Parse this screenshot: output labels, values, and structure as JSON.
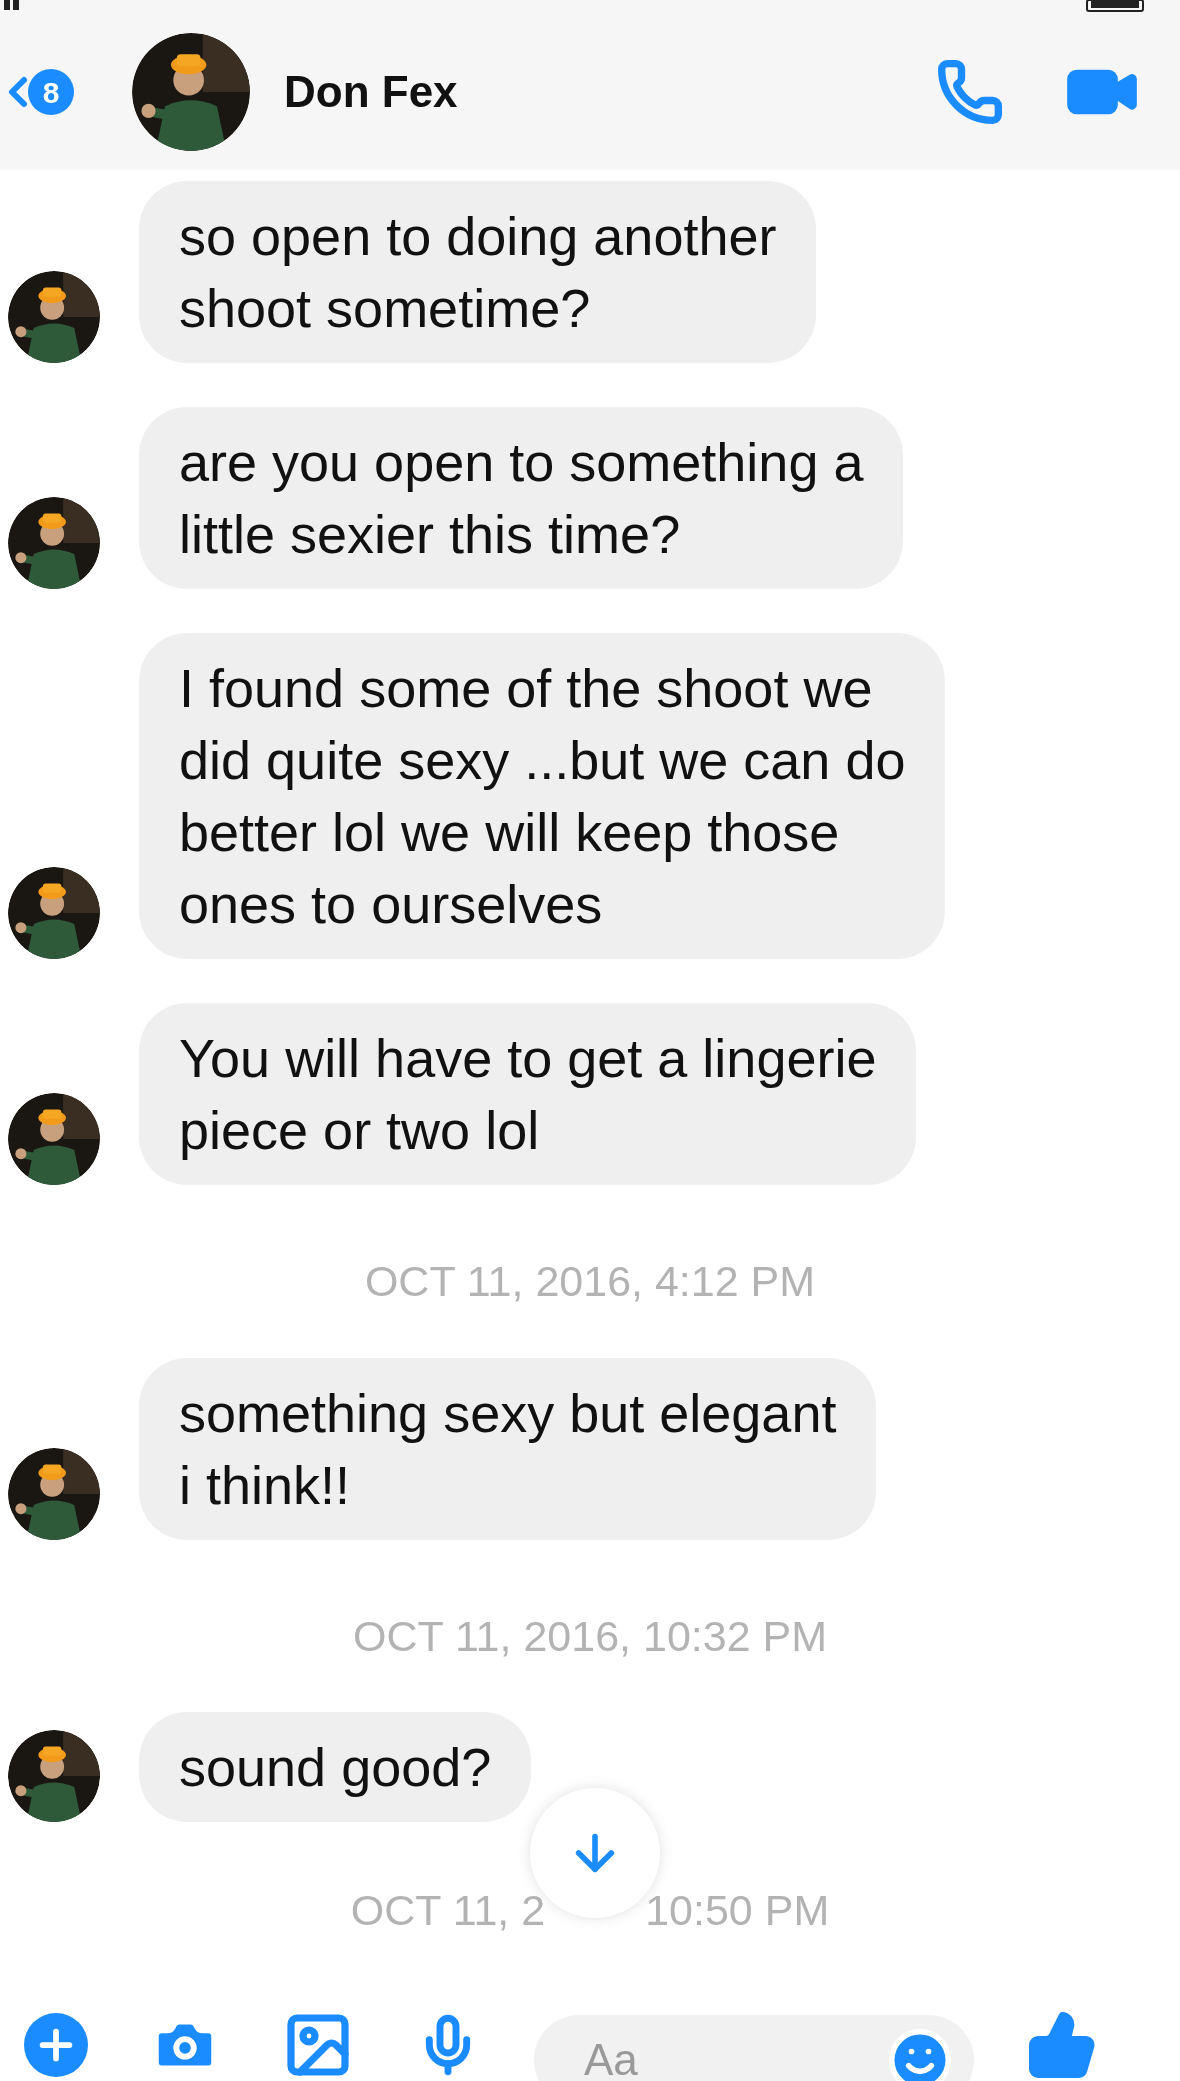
{
  "header": {
    "back_badge": "8",
    "contact_name": "Don Fex"
  },
  "messages": [
    {
      "kind": "bubble",
      "lines": [
        "so open to doing another",
        "shoot sometime?"
      ]
    },
    {
      "kind": "bubble",
      "lines": [
        "are you open to something a",
        "little sexier this time?"
      ]
    },
    {
      "kind": "bubble",
      "lines": [
        "I found some of the shoot we",
        "did quite sexy ...but we can do",
        "better lol we will keep those",
        "ones to ourselves"
      ]
    },
    {
      "kind": "bubble",
      "lines": [
        "You will have to get a lingerie",
        "piece or two lol"
      ]
    },
    {
      "kind": "timestamp",
      "text": "OCT 11, 2016, 4:12 PM"
    },
    {
      "kind": "bubble",
      "lines": [
        "something sexy but elegant",
        "i think!!"
      ]
    },
    {
      "kind": "timestamp",
      "text": "OCT 11, 2016, 10:32 PM"
    },
    {
      "kind": "bubble",
      "lines": [
        "sound good?"
      ]
    },
    {
      "kind": "covered_timestamp",
      "parts": [
        "OCT 11, 2",
        "10:50 PM"
      ]
    }
  ],
  "composer": {
    "placeholder": "Aa"
  }
}
